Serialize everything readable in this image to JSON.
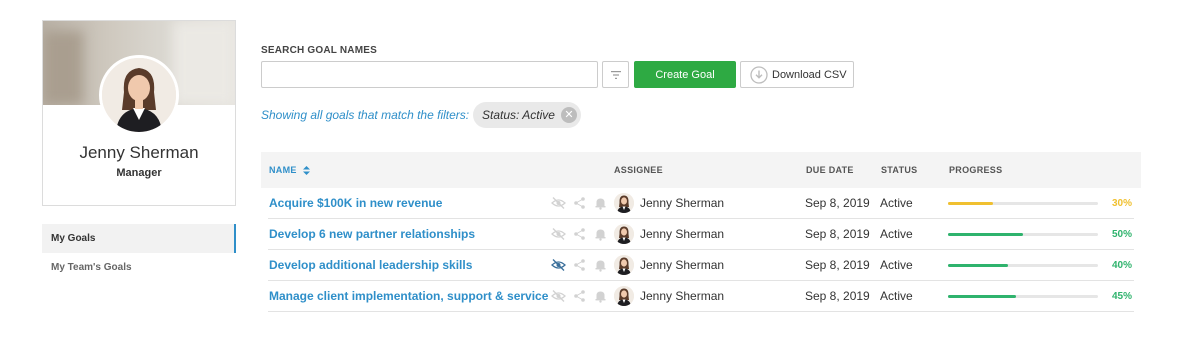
{
  "profile": {
    "name": "Jenny Sherman",
    "role": "Manager"
  },
  "sidenav": {
    "items": [
      {
        "label": "My Goals",
        "active": true
      },
      {
        "label": "My Team's Goals",
        "active": false
      }
    ]
  },
  "search": {
    "label": "SEARCH GOAL NAMES",
    "value": "",
    "placeholder": ""
  },
  "toolbar": {
    "filter_icon": "filter-icon",
    "create_label": "Create Goal",
    "download_label": "Download CSV",
    "download_icon": "download-icon"
  },
  "filters": {
    "text": "Showing all goals that match the filters:",
    "chips": [
      {
        "label": "Status: Active"
      }
    ]
  },
  "table": {
    "columns": {
      "name": "NAME",
      "assignee": "ASSIGNEE",
      "due": "DUE DATE",
      "status": "STATUS",
      "progress": "PROGRESS"
    },
    "rows": [
      {
        "name": "Acquire $100K in new revenue",
        "assignee": "Jenny Sherman",
        "due": "Sep 8, 2019",
        "status": "Active",
        "progress": 30,
        "progress_label": "30%",
        "color": "#f0c030",
        "hidden_active": false
      },
      {
        "name": "Develop 6 new partner relationships",
        "assignee": "Jenny Sherman",
        "due": "Sep 8, 2019",
        "status": "Active",
        "progress": 50,
        "progress_label": "50%",
        "color": "#2fb36d",
        "hidden_active": false
      },
      {
        "name": "Develop additional leadership skills",
        "assignee": "Jenny Sherman",
        "due": "Sep 8, 2019",
        "status": "Active",
        "progress": 40,
        "progress_label": "40%",
        "color": "#2fb36d",
        "hidden_active": true
      },
      {
        "name": "Manage client implementation, support & service",
        "assignee": "Jenny Sherman",
        "due": "Sep 8, 2019",
        "status": "Active",
        "progress": 45,
        "progress_label": "45%",
        "color": "#2fb36d",
        "hidden_active": false
      }
    ]
  },
  "colors": {
    "accent": "#2f8fc9",
    "primary_button": "#2eaa43",
    "progress_warn": "#f0c030",
    "progress_ok": "#2fb36d"
  }
}
